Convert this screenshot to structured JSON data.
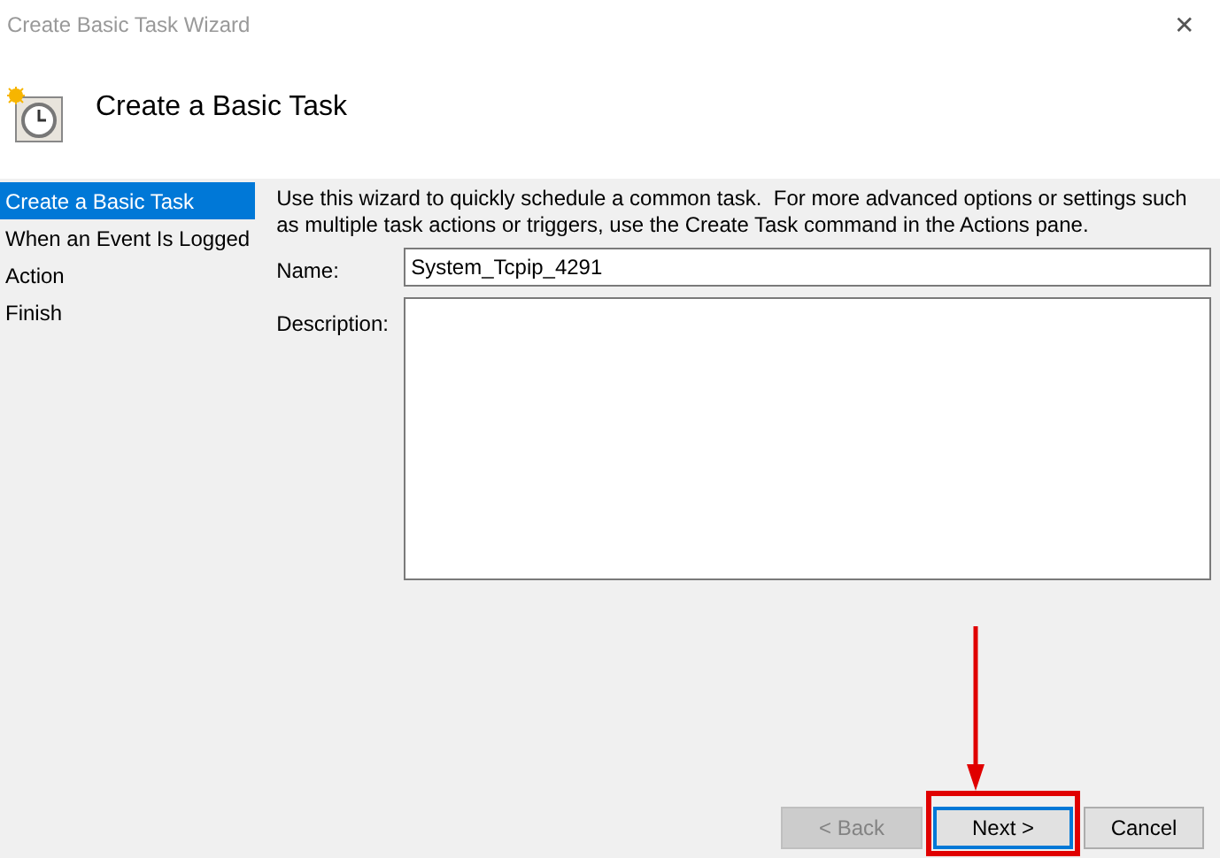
{
  "window": {
    "title": "Create Basic Task Wizard",
    "close": "✕"
  },
  "header": {
    "title": "Create a Basic Task"
  },
  "steps": [
    {
      "label": "Create a Basic Task",
      "selected": true
    },
    {
      "label": "When an Event Is Logged",
      "selected": false
    },
    {
      "label": "Action",
      "selected": false
    },
    {
      "label": "Finish",
      "selected": false
    }
  ],
  "intro": "Use this wizard to quickly schedule a common task.  For more advanced options or settings such as multiple task actions or triggers, use the Create Task command in the Actions pane.",
  "fields": [
    {
      "kind": "text",
      "label": "Name:",
      "value": "System_Tcpip_4291"
    },
    {
      "kind": "multiline",
      "label": "Description:"
    }
  ],
  "buttons": [
    {
      "label": "< Back",
      "disabled": true,
      "default": false,
      "highlighted": false
    },
    {
      "label": "Next >",
      "disabled": false,
      "default": true,
      "highlighted": true
    },
    {
      "label": "Cancel",
      "disabled": false,
      "default": false,
      "highlighted": false
    }
  ]
}
